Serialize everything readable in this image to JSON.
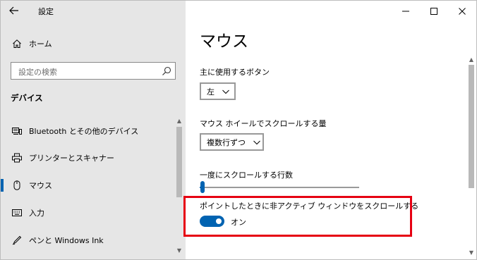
{
  "window": {
    "title": "設定",
    "controls": {
      "minimize": "—",
      "maximize": "☐",
      "close": "✕"
    }
  },
  "sidebar": {
    "back_icon": "arrow-left-icon",
    "home": {
      "label": "ホーム",
      "icon": "home-icon"
    },
    "search": {
      "placeholder": "設定の検索",
      "icon": "search-icon"
    },
    "section": "デバイス",
    "items": [
      {
        "label": "Bluetooth とその他のデバイス",
        "icon": "bluetooth-devices-icon",
        "selected": false
      },
      {
        "label": "プリンターとスキャナー",
        "icon": "printer-icon",
        "selected": false
      },
      {
        "label": "マウス",
        "icon": "mouse-icon",
        "selected": true
      },
      {
        "label": "入力",
        "icon": "keyboard-icon",
        "selected": false
      },
      {
        "label": "ペンと Windows Ink",
        "icon": "pen-icon",
        "selected": false
      }
    ]
  },
  "main": {
    "title": "マウス",
    "primary_button": {
      "label": "主に使用するボタン",
      "value": "左"
    },
    "wheel_scroll": {
      "label": "マウス ホイールでスクロールする量",
      "value": "複数行ずつ"
    },
    "lines_to_scroll": {
      "label": "一度にスクロールする行数",
      "value_fraction": 0.01
    },
    "inactive_scroll": {
      "label": "ポイントしたときに非アクティブ ウィンドウをスクロールする",
      "state_label": "オン",
      "on": true
    }
  },
  "colors": {
    "accent": "#0063b1",
    "highlight": "#e60012",
    "sidebar_bg": "#e6e6e6"
  }
}
